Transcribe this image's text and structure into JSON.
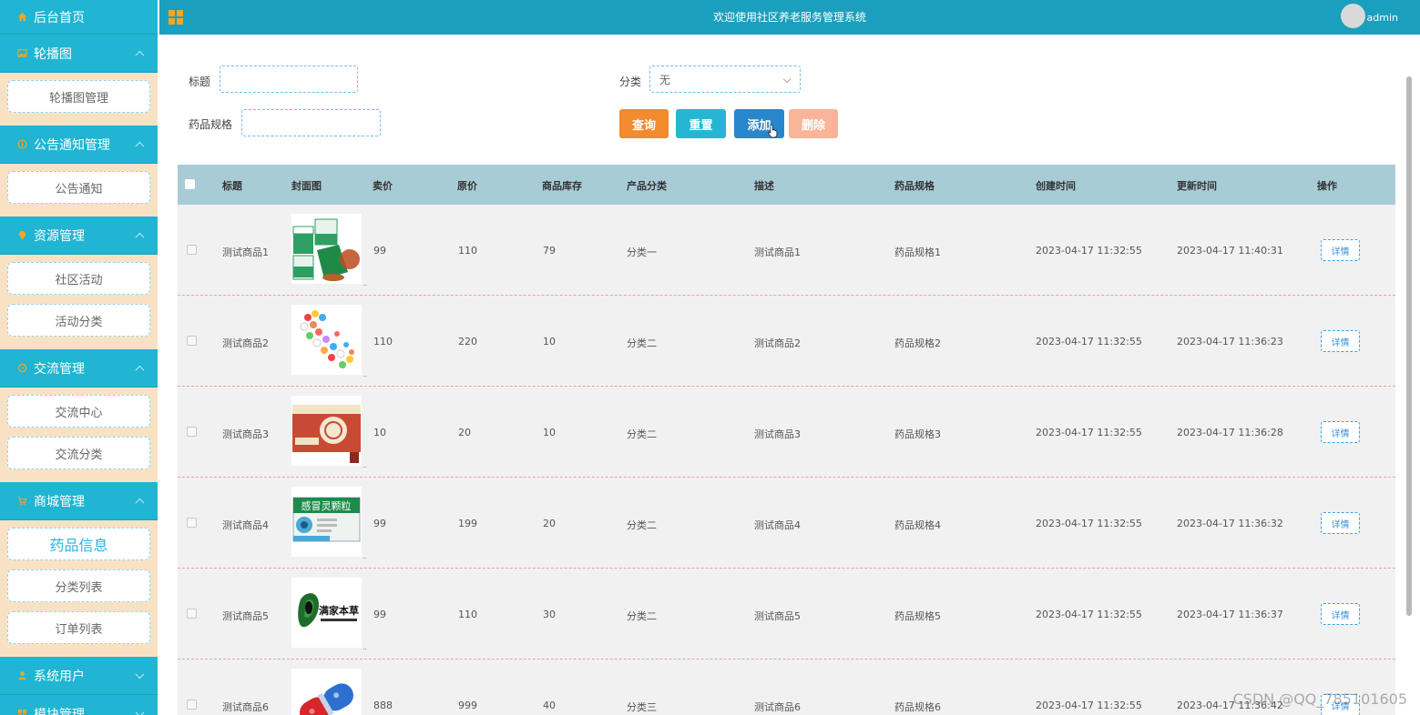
{
  "sidebar": {
    "home": "后台首页",
    "groups": [
      {
        "label": "轮播图",
        "icon": "image-icon",
        "items": [
          "轮播图管理"
        ]
      },
      {
        "label": "公告通知管理",
        "icon": "info-icon",
        "items": [
          "公告通知"
        ]
      },
      {
        "label": "资源管理",
        "icon": "location-icon",
        "items": [
          "社区活动",
          "活动分类"
        ]
      },
      {
        "label": "交流管理",
        "icon": "chat-icon",
        "items": [
          "交流中心",
          "交流分类"
        ]
      },
      {
        "label": "商城管理",
        "icon": "cart-icon",
        "items": [
          "药品信息",
          "分类列表",
          "订单列表"
        ],
        "active_item": "药品信息"
      },
      {
        "label": "系统用户",
        "icon": "user-icon",
        "items": []
      },
      {
        "label": "模块管理",
        "icon": "grid-icon",
        "items": []
      }
    ]
  },
  "header": {
    "title": "欢迎使用社区养老服务管理系统",
    "user": "admin"
  },
  "search": {
    "title_label": "标题",
    "title_value": "",
    "category_label": "分类",
    "category_value": "无",
    "spec_label": "药品规格",
    "spec_value": ""
  },
  "buttons": {
    "search": "查询",
    "reset": "重置",
    "add": "添加",
    "delete": "删除"
  },
  "table": {
    "columns": [
      "标题",
      "封面图",
      "卖价",
      "原价",
      "商品库存",
      "产品分类",
      "描述",
      "药品规格",
      "创建时间",
      "更新时间",
      "操作"
    ],
    "detail_label": "详情",
    "rows": [
      {
        "title": "测试商品1",
        "price": "99",
        "orig": "110",
        "stock": "79",
        "cat": "分类一",
        "desc": "测试商品1",
        "spec": "药品规格1",
        "created": "2023-04-17 11:32:55",
        "updated": "2023-04-17 11:40:31"
      },
      {
        "title": "测试商品2",
        "price": "110",
        "orig": "220",
        "stock": "10",
        "cat": "分类二",
        "desc": "测试商品2",
        "spec": "药品规格2",
        "created": "2023-04-17 11:32:55",
        "updated": "2023-04-17 11:36:23"
      },
      {
        "title": "测试商品3",
        "price": "10",
        "orig": "20",
        "stock": "10",
        "cat": "分类二",
        "desc": "测试商品3",
        "spec": "药品规格3",
        "created": "2023-04-17 11:32:55",
        "updated": "2023-04-17 11:36:28"
      },
      {
        "title": "测试商品4",
        "price": "99",
        "orig": "199",
        "stock": "20",
        "cat": "分类二",
        "desc": "测试商品4",
        "spec": "药品规格4",
        "created": "2023-04-17 11:32:55",
        "updated": "2023-04-17 11:36:32"
      },
      {
        "title": "测试商品5",
        "price": "99",
        "orig": "110",
        "stock": "30",
        "cat": "分类二",
        "desc": "测试商品5",
        "spec": "药品规格5",
        "created": "2023-04-17 11:32:55",
        "updated": "2023-04-17 11:36:37"
      },
      {
        "title": "测试商品6",
        "price": "888",
        "orig": "999",
        "stock": "40",
        "cat": "分类三",
        "desc": "测试商品6",
        "spec": "药品规格6",
        "created": "2023-04-17 11:32:55",
        "updated": "2023-04-17 11:36:42"
      }
    ]
  },
  "cover_texts": {
    "row4": "感冒灵颗粒",
    "row5": "满家本草"
  },
  "watermark": "CSDN @QQ_785101605",
  "colors": {
    "sidebar_bg": "#f9e2c4",
    "menu_head": "#1fb5d3",
    "topbar": "#1b9fbe",
    "table_head": "#a8ccd6",
    "btn_search": "#f28a2e",
    "btn_reset": "#26b6d3",
    "btn_add": "#2887cc",
    "btn_delete": "#f9b49a"
  }
}
